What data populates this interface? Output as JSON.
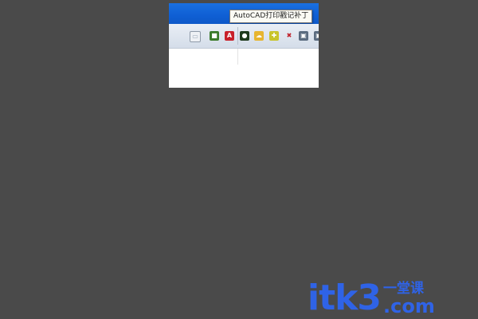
{
  "tooltip": {
    "text": "AutoCAD打印戳记补丁"
  },
  "tray_icons": [
    {
      "name": "keyboard-icon",
      "glyph": "▭",
      "color": "#9aa7b8"
    },
    {
      "name": "nvidia-icon",
      "glyph": "■",
      "color": "#3a7a2a"
    },
    {
      "name": "autocad-icon",
      "glyph": "A",
      "color": "#c8202a"
    },
    {
      "name": "gamepad-icon",
      "glyph": "●",
      "color": "#1e3a1e"
    },
    {
      "name": "weather-icon",
      "glyph": "☁",
      "color": "#e7b530"
    },
    {
      "name": "security-icon",
      "glyph": "✚",
      "color": "#c8c42a"
    },
    {
      "name": "no-entry-icon",
      "glyph": "✖",
      "color": "#d6d6d6"
    },
    {
      "name": "monitor-icon",
      "glyph": "▣",
      "color": "#5b6c80"
    },
    {
      "name": "monitor-icon-2",
      "glyph": "▣",
      "color": "#5b6c80"
    }
  ],
  "watermark": {
    "main": "itk3",
    "cn": "一堂课",
    "com": ".com"
  }
}
